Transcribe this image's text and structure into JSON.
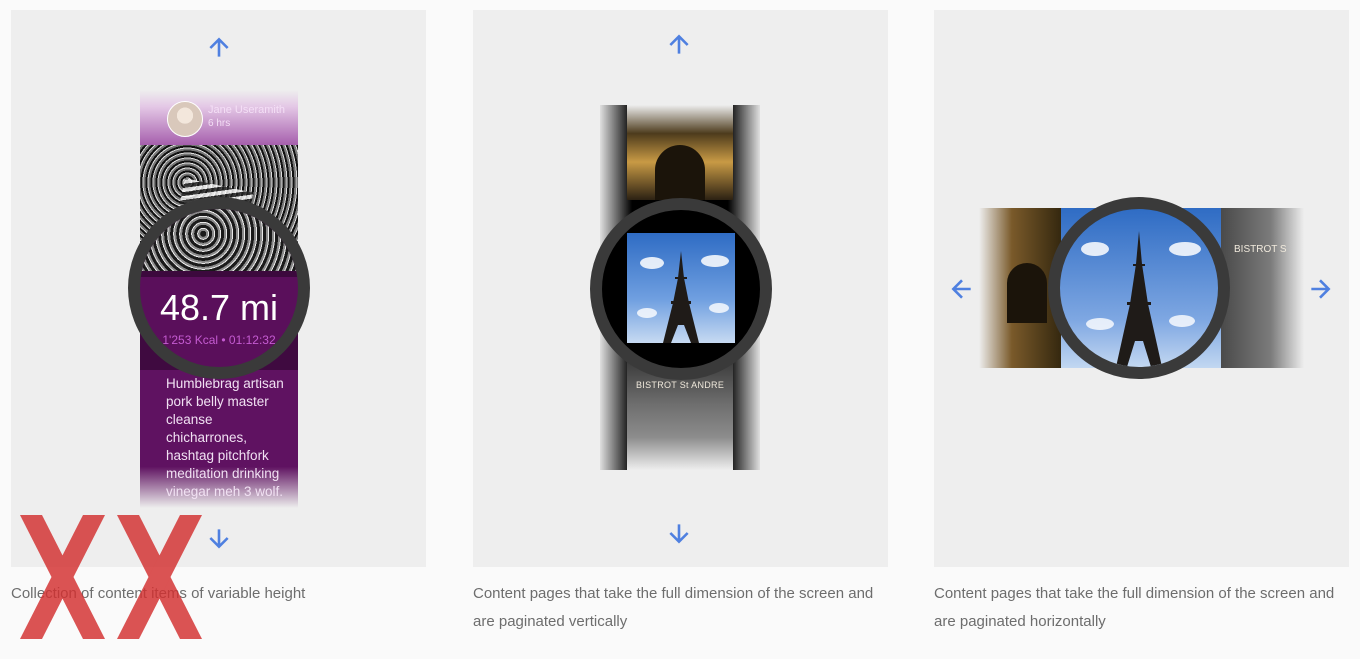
{
  "panels": [
    {
      "caption": "Collection of content items of variable height",
      "card": {
        "user_name": "Jane Useramith",
        "user_meta": "6 hrs",
        "stat_value": "48.7 mi",
        "stat_sub": "1'253 Kcal • 01:12:32",
        "body_text": "Humblebrag artisan pork belly master cleanse chicharrones, hashtag pitchfork meditation drinking vinegar meh 3 wolf."
      },
      "arrows": [
        "arrow-up-icon",
        "arrow-down-icon"
      ]
    },
    {
      "caption": "Content pages that take the full dimension of the screen and are paginated vertically",
      "bistro_label": "BISTROT St ANDRE",
      "arrows": [
        "arrow-up-icon",
        "arrow-down-icon"
      ]
    },
    {
      "caption": "Content pages that take the full dimension of the screen and are paginated horizontally",
      "bistro_label": "BISTROT S",
      "arrows": [
        "arrow-left-icon",
        "arrow-right-icon"
      ]
    }
  ],
  "colors": {
    "arrow": "#4f80e0",
    "panel_bg": "#eeeeee",
    "watch_bezel": "#3a3a3a",
    "purple": "#5e0f5f",
    "overlay_red": "#d32f2f"
  }
}
